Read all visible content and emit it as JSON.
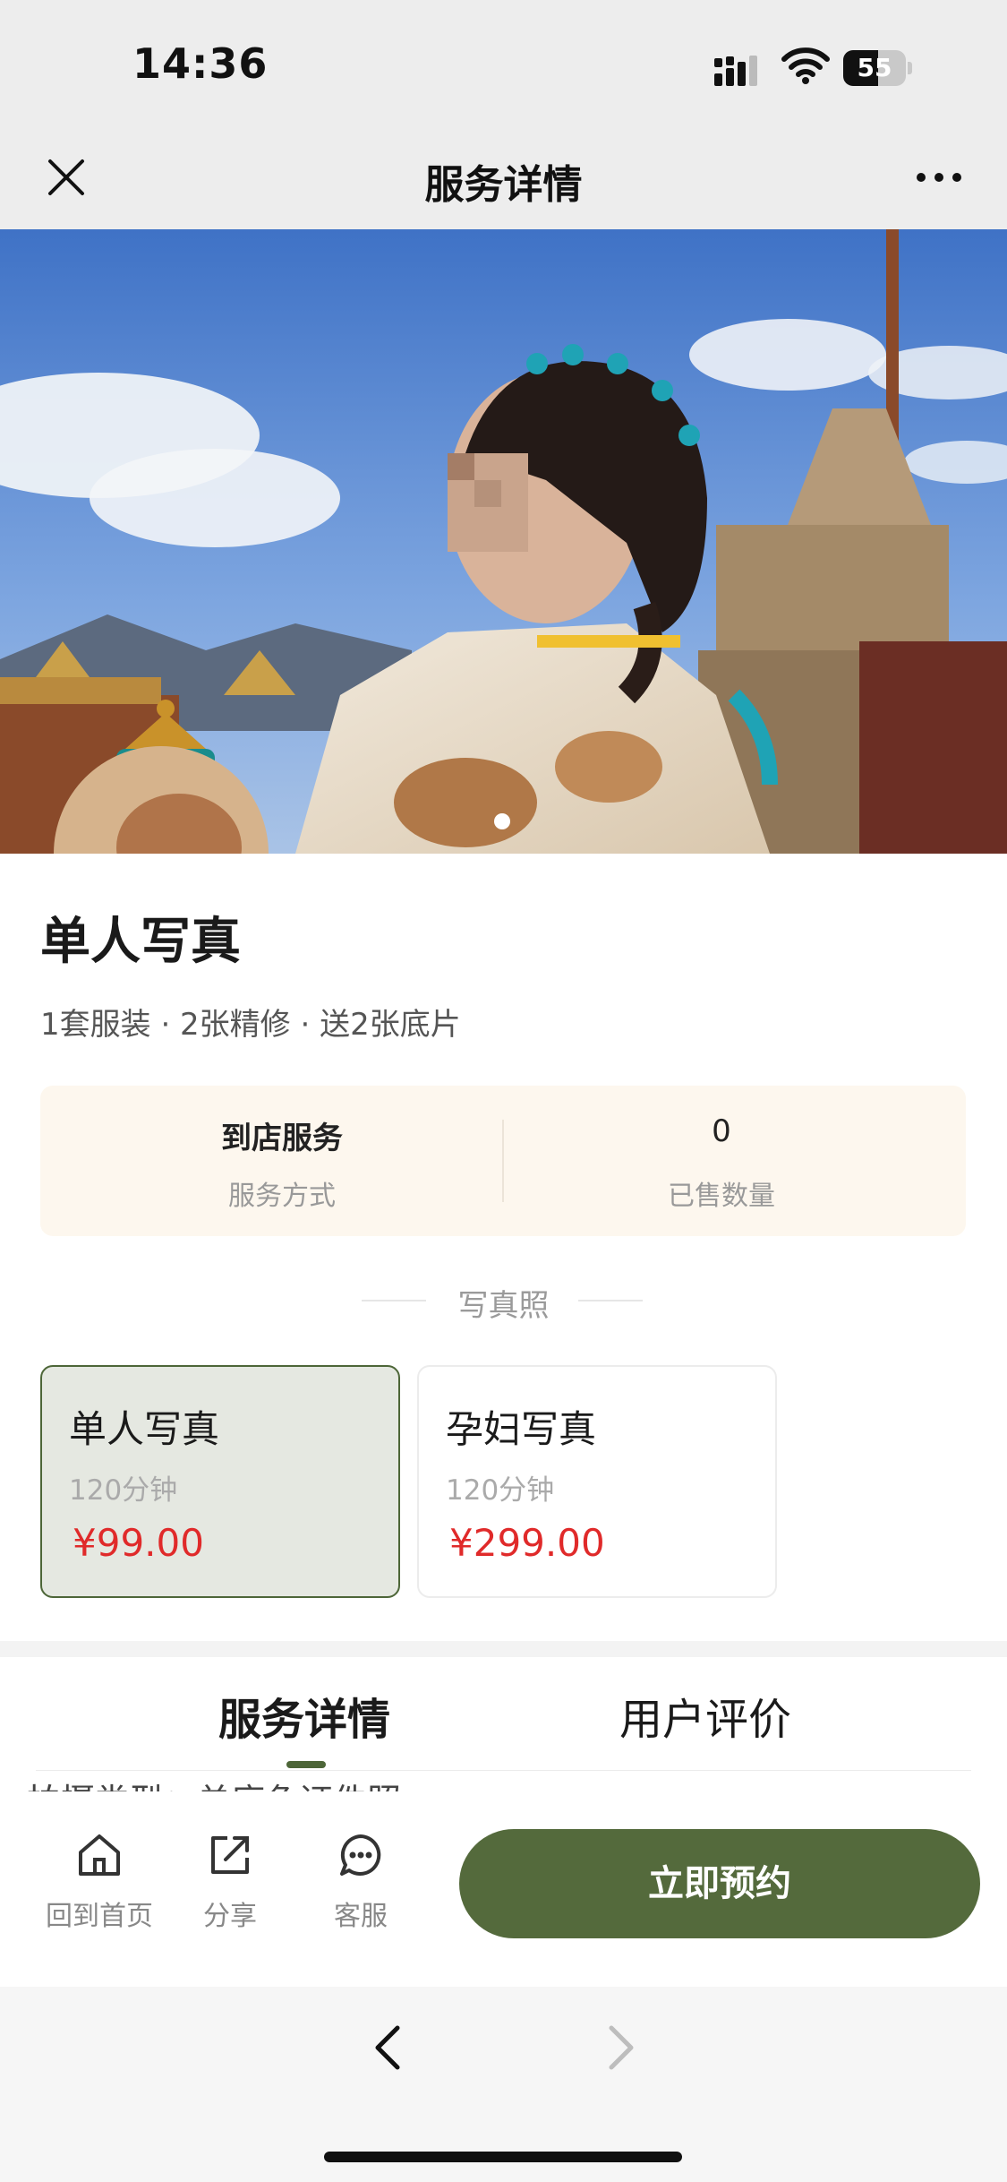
{
  "status_bar": {
    "time": "14:36",
    "battery": "55",
    "battery_level": 0.55
  },
  "nav": {
    "title": "服务详情",
    "close_icon": "close-icon",
    "more_icon": "more-icon"
  },
  "hero": {
    "image": "hero-photo",
    "page_index": 1,
    "page_count": 1
  },
  "product": {
    "title": "单人写真",
    "subtitle": "1套服装 · 2张精修 · 送2张底片",
    "service_mode": "到店服务",
    "service_mode_label": "服务方式",
    "sold_count": "0",
    "sold_label": "已售数量"
  },
  "section": {
    "label": "写真照"
  },
  "packages": [
    {
      "name": "单人写真",
      "duration": "120分钟",
      "price": "¥99.00",
      "selected": true
    },
    {
      "name": "孕妇写真",
      "duration": "120分钟",
      "price": "¥299.00",
      "selected": false
    }
  ],
  "tabs": [
    {
      "label": "服务详情",
      "active": true
    },
    {
      "label": "用户评价",
      "active": false
    }
  ],
  "detail": {
    "line": "拍摄类型：单底色证件照"
  },
  "actions": [
    {
      "label": "回到首页",
      "icon": "home-icon"
    },
    {
      "label": "分享",
      "icon": "share-icon"
    },
    {
      "label": "客服",
      "icon": "customer-service-icon"
    }
  ],
  "book_button": {
    "label": "立即预约"
  },
  "colors": {
    "accent": "#546a3c",
    "price": "#e02a2a",
    "info_bg": "#fdf7ee"
  }
}
